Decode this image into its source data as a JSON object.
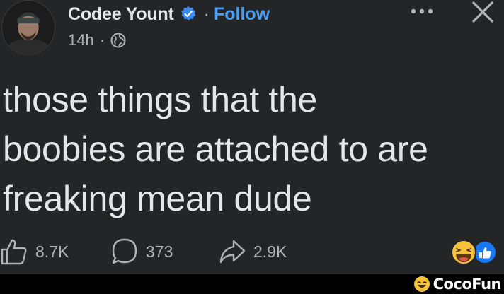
{
  "post": {
    "author": "Codee Yount",
    "separator": "·",
    "follow_label": "Follow",
    "timestamp": "14h",
    "meta_separator": "·",
    "audience_icon": "globe-icon",
    "text_lines": [
      "those things that the",
      "boobies are attached to are",
      "freaking mean dude"
    ]
  },
  "actions": {
    "like_count": "8.7K",
    "comment_count": "373",
    "share_count": "2.9K"
  },
  "reactions": [
    "haha-icon",
    "like-icon"
  ],
  "watermark": {
    "brand": "CocoFun"
  },
  "colors": {
    "background": "#242526",
    "text": "#e4e6eb",
    "secondary": "#b0b3b8",
    "accent": "#4a9df5",
    "footer": "#000000"
  }
}
